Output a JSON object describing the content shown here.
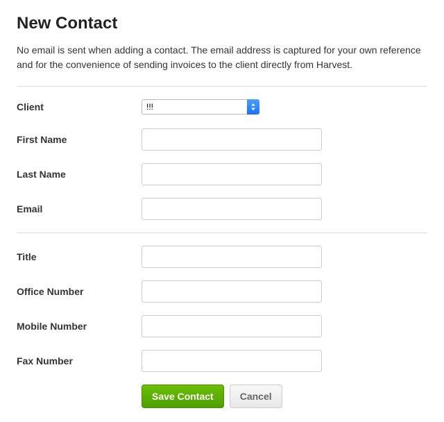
{
  "page": {
    "title": "New Contact",
    "description": "No email is sent when adding a contact. The email address is captured for your own reference and for the convenience of sending invoices to the client directly from Harvest."
  },
  "form": {
    "client": {
      "label": "Client",
      "selected": "!!!"
    },
    "first_name": {
      "label": "First Name",
      "value": ""
    },
    "last_name": {
      "label": "Last Name",
      "value": ""
    },
    "email": {
      "label": "Email",
      "value": ""
    },
    "title": {
      "label": "Title",
      "value": ""
    },
    "office_number": {
      "label": "Office Number",
      "value": ""
    },
    "mobile_number": {
      "label": "Mobile Number",
      "value": ""
    },
    "fax_number": {
      "label": "Fax Number",
      "value": ""
    }
  },
  "buttons": {
    "save": "Save Contact",
    "cancel": "Cancel"
  }
}
